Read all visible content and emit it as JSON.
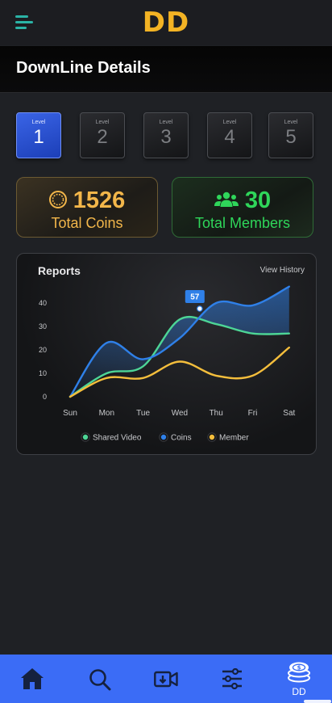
{
  "app": {
    "brand": "DD"
  },
  "header": {
    "title": "DownLine Details"
  },
  "levels": {
    "label": "Level",
    "items": [
      {
        "num": "1",
        "active": true
      },
      {
        "num": "2",
        "active": false
      },
      {
        "num": "3",
        "active": false
      },
      {
        "num": "4",
        "active": false
      },
      {
        "num": "5",
        "active": false
      }
    ]
  },
  "stats": {
    "coins": {
      "value": "1526",
      "label": "Total Coins",
      "icon": "coin-icon"
    },
    "members": {
      "value": "30",
      "label": "Total Members",
      "icon": "users-icon"
    }
  },
  "reports": {
    "title": "Reports",
    "view_history": "View History",
    "tooltip": "57"
  },
  "chart_data": {
    "type": "line",
    "title": "Reports",
    "categories": [
      "Sun",
      "Mon",
      "Tue",
      "Wed",
      "Thu",
      "Fri",
      "Sat"
    ],
    "yticks": [
      0,
      10,
      20,
      30,
      40
    ],
    "ylim": [
      0,
      50
    ],
    "series": [
      {
        "name": "Shared Video",
        "color": "#4dd596",
        "values": [
          0,
          10,
          13,
          33,
          31,
          27,
          27
        ]
      },
      {
        "name": "Coins",
        "color": "#2f80e8",
        "values": [
          0,
          23,
          16,
          25,
          40,
          39,
          47
        ]
      },
      {
        "name": "Member",
        "color": "#f4be3c",
        "values": [
          0,
          8,
          8,
          15,
          9,
          9,
          21
        ]
      }
    ],
    "highlight": {
      "series": "Coins",
      "x": 3.55,
      "label": "57"
    },
    "legend_placement": "bottom"
  },
  "nav": {
    "items": [
      {
        "icon": "home-icon"
      },
      {
        "icon": "search-icon"
      },
      {
        "icon": "video-download-icon"
      },
      {
        "icon": "sliders-icon"
      },
      {
        "icon": "coins-stack-icon",
        "label": "DD"
      }
    ],
    "accent": "#3b6cf6"
  }
}
